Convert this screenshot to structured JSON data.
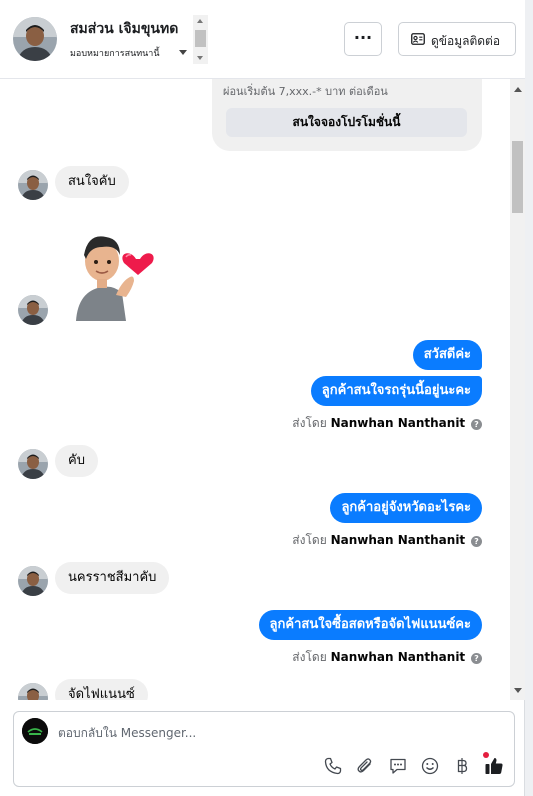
{
  "header": {
    "name": "สมส่วน เจิมขุนทด",
    "assign_label": "มอบหมายการสนทนานี้",
    "more_label": "···",
    "contact_label": "ดูข้อมูลติดต่อ"
  },
  "promo": {
    "text": "ผ่อนเริ่มต้น 7,xxx.-* บาท ต่อเดือน",
    "button_label": "สนใจจองโปรโมชั่นนี้"
  },
  "messages": {
    "in_1": "สนใจคับ",
    "out_1": "สวัสดีค่ะ",
    "out_2": "ลูกค้าสนใจรถรุ่นนี้อยู่นะคะ",
    "in_2": "คับ",
    "out_3": "ลูกค้าอยู่จังหวัดอะไรคะ",
    "in_3": "นครราชสีมาคับ",
    "out_4": "ลูกค้าสนใจซื้อสดหรือจัดไฟแนนซ์คะ",
    "in_4": "จัดไฟแนนซ์"
  },
  "sent_by": {
    "prefix": "ส่งโดย",
    "agent": "Nanwhan Nanthanit",
    "info_glyph": "?"
  },
  "composer": {
    "placeholder": "ตอบกลับใน Messenger..."
  },
  "icons": {
    "tools": [
      "phone-icon",
      "paperclip-icon",
      "saved-reply-icon",
      "emoji-icon",
      "baht-payment-icon",
      "thumbs-up-icon"
    ]
  },
  "colors": {
    "outgoing_bubble": "#0a7cff",
    "incoming_bubble": "#f0f0f0",
    "notification_dot": "#e41e3f"
  }
}
